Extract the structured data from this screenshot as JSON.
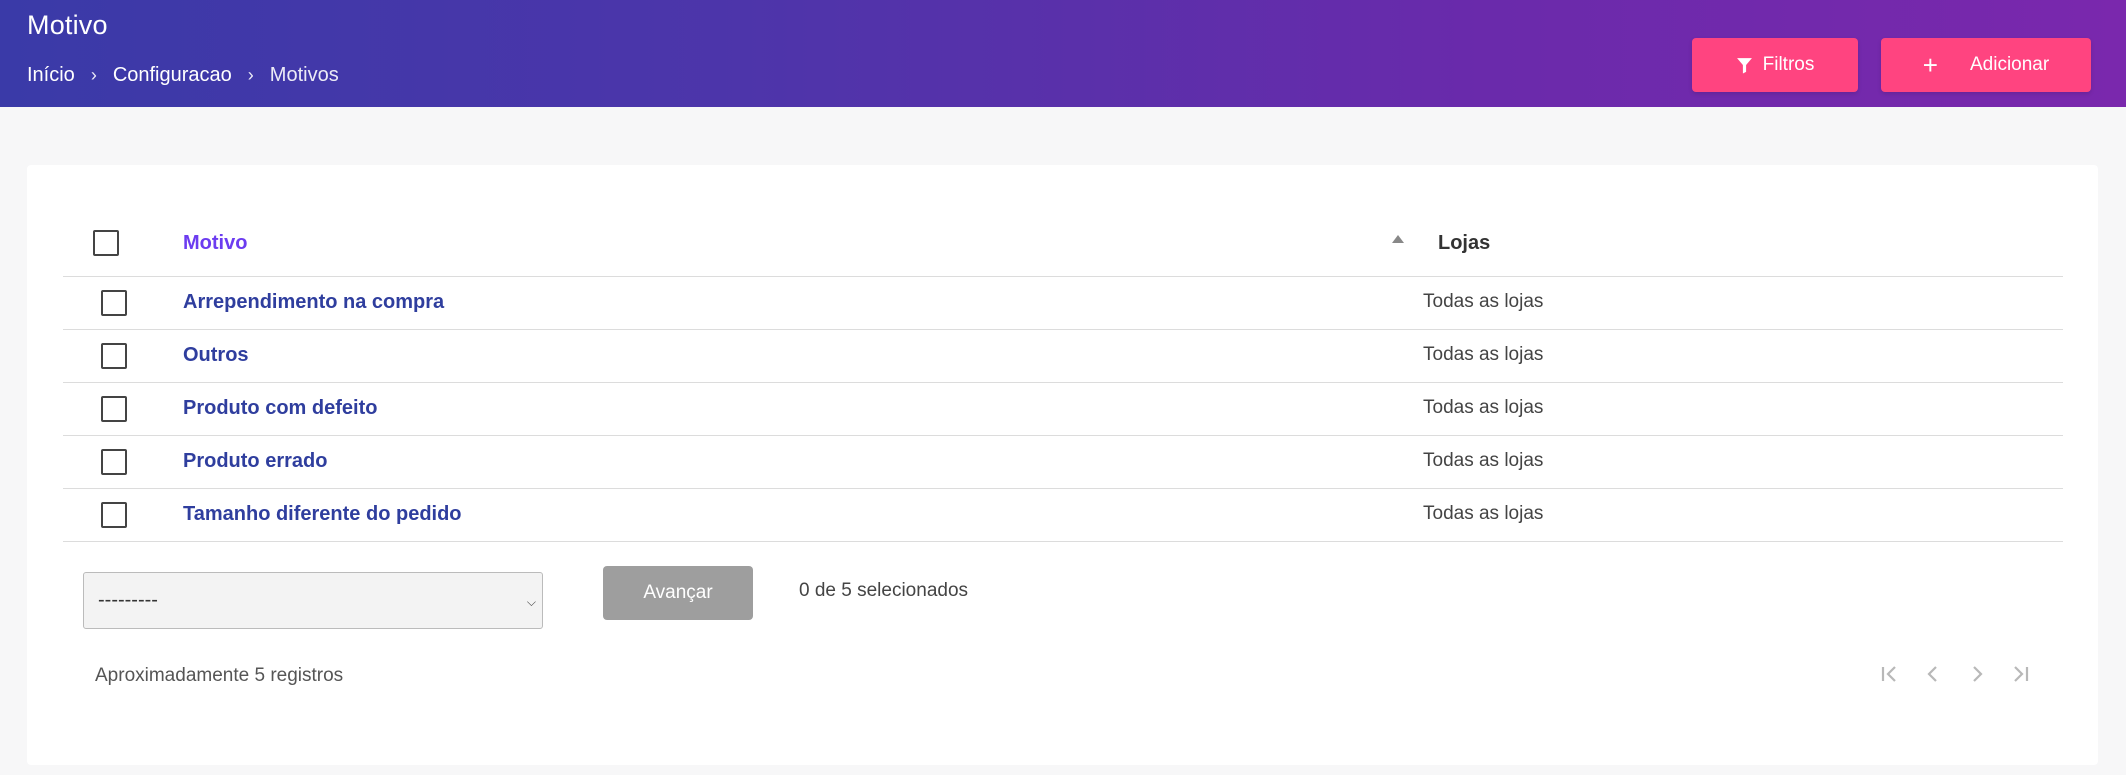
{
  "header": {
    "title": "Motivo",
    "breadcrumb": [
      "Início",
      "Configuracao",
      "Motivos"
    ],
    "filter_label": "Filtros",
    "add_label": "Adicionar"
  },
  "table": {
    "columns": [
      "Motivo",
      "Lojas"
    ],
    "rows": [
      {
        "motivo": "Arrependimento na compra",
        "lojas": "Todas as lojas"
      },
      {
        "motivo": "Outros",
        "lojas": "Todas as lojas"
      },
      {
        "motivo": "Produto com defeito",
        "lojas": "Todas as lojas"
      },
      {
        "motivo": "Produto errado",
        "lojas": "Todas as lojas"
      },
      {
        "motivo": "Tamanho diferente do pedido",
        "lojas": "Todas as lojas"
      }
    ],
    "sort": "ascending"
  },
  "footer": {
    "bulk_action_value": "---------",
    "advance_label": "Avançar",
    "selected_text": "0 de 5 selecionados",
    "records_text": "Aproximadamente 5 registros"
  },
  "colors": {
    "header_gradient_start": "#3a3aa8",
    "header_gradient_end": "#7a28ad",
    "accent_pink": "#ff4480",
    "link_blue": "#2f3e9e",
    "sorted_header": "#6c3cf0",
    "disabled_gray": "#9e9e9e"
  },
  "icons": {
    "filter": "filter-icon",
    "add": "plus-icon",
    "sort": "sort-up-icon",
    "pager": [
      "first-page-icon",
      "prev-page-icon",
      "next-page-icon",
      "last-page-icon"
    ]
  }
}
